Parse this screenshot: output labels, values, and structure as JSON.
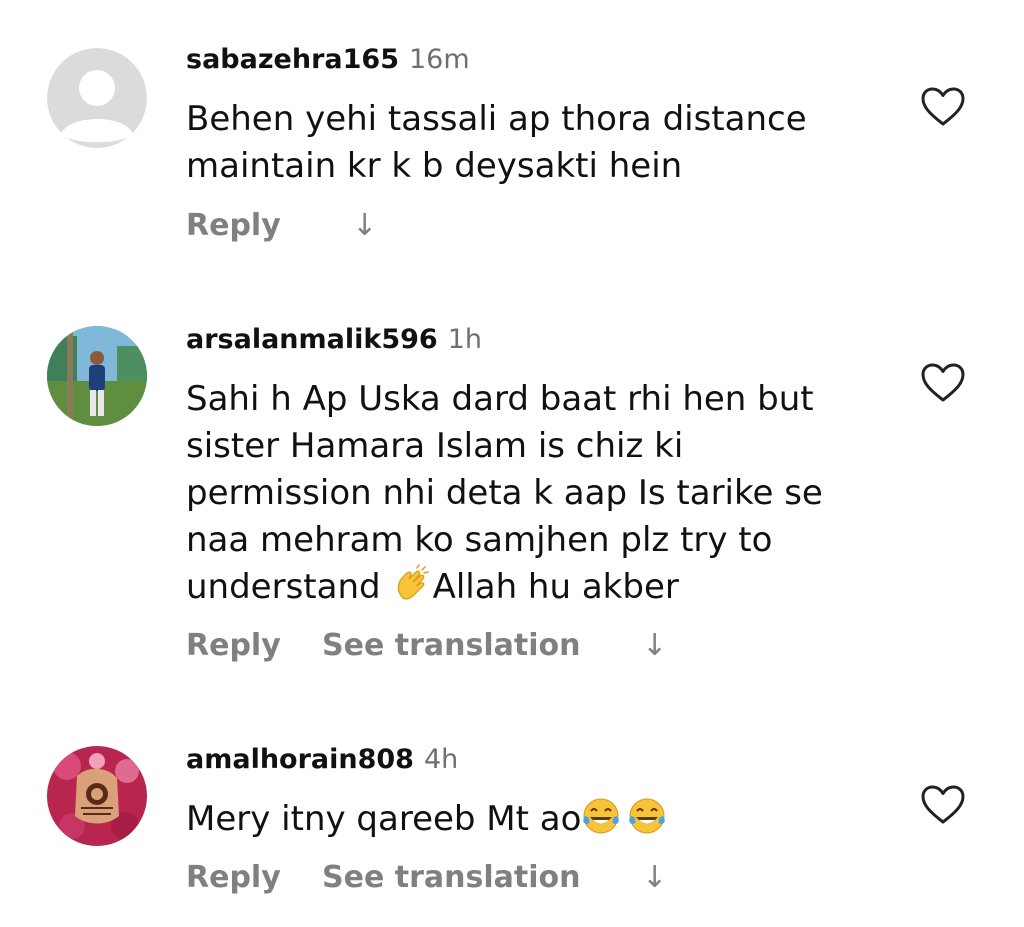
{
  "comments": [
    {
      "username": "sabazehra165",
      "time": "16m",
      "lines": [
        "Behen yehi tassali ap thora distance",
        "maintain kr k b deysakti hein"
      ],
      "reply_label": "Reply",
      "translate_label": "",
      "arrow": "↓",
      "avatar_icon": "default-avatar-icon"
    },
    {
      "username": "arsalanmalik596",
      "time": "1h",
      "lines": [
        "Sahi h Ap Uska dard baat rhi hen but",
        "sister Hamara Islam is chiz ki",
        "permission nhi deta k aap Is tarike se",
        "naa mehram ko samjhen plz try to",
        "understand",
        "Allah hu akber"
      ],
      "emoji_icon": "clapping-hands-emoji",
      "reply_label": "Reply",
      "translate_label": "See translation",
      "arrow": "↓",
      "avatar_icon": "user-photo-avatar"
    },
    {
      "username": "amalhorain808",
      "time": "4h",
      "lines": [
        "Mery itny qareeb Mt ao"
      ],
      "emoji_icon": "tears-of-joy-emoji",
      "reply_label": "Reply",
      "translate_label": "See translation",
      "arrow": "↓",
      "avatar_icon": "henna-photo-avatar"
    }
  ],
  "colors": {
    "text": "#111111",
    "muted": "#6f6f6f",
    "action": "#808080",
    "default_avatar_bg": "#dbdbdb",
    "emoji_yellow": "#f7c33a"
  }
}
